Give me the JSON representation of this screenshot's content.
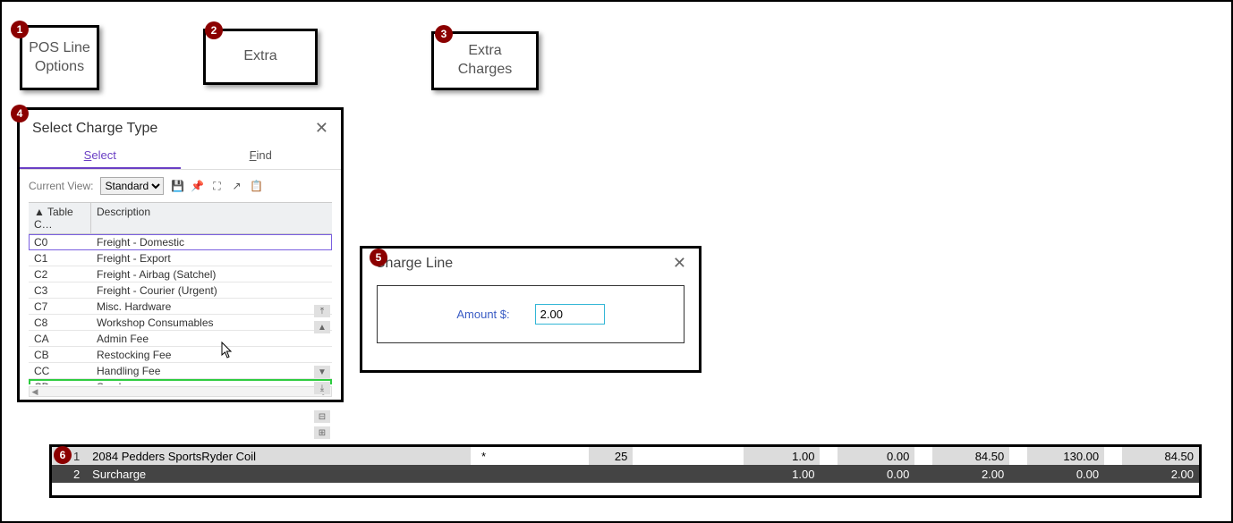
{
  "badges": [
    "1",
    "2",
    "3",
    "4",
    "5",
    "6"
  ],
  "cards": {
    "pos": "POS Line Options",
    "extra": "Extra",
    "charges": "Extra Charges"
  },
  "dlg4": {
    "title": "Select Charge Type",
    "tabs": {
      "select": "Select",
      "find": "Find",
      "select_underlined": "S",
      "find_underlined": "F"
    },
    "toolbar": {
      "label": "Current View:",
      "view": "Standard"
    },
    "cols": {
      "code": "▲ Table C…",
      "desc": "Description"
    },
    "rows": [
      {
        "code": "C0",
        "desc": "Freight - Domestic"
      },
      {
        "code": "C1",
        "desc": "Freight - Export"
      },
      {
        "code": "C2",
        "desc": "Freight - Airbag (Satchel)"
      },
      {
        "code": "C3",
        "desc": "Freight - Courier (Urgent)"
      },
      {
        "code": "C7",
        "desc": "Misc. Hardware"
      },
      {
        "code": "C8",
        "desc": "Workshop Consumables"
      },
      {
        "code": "CA",
        "desc": "Admin Fee"
      },
      {
        "code": "CB",
        "desc": "Restocking Fee"
      },
      {
        "code": "CC",
        "desc": "Handling Fee"
      },
      {
        "code": "CD",
        "desc": "Surcharge"
      }
    ],
    "selected_index": 0,
    "highlight_index": 9
  },
  "dlg5": {
    "title": "Charge Line",
    "label": "Amount $:",
    "value": "2.00"
  },
  "bottom": {
    "rows": [
      {
        "idx": "1",
        "desc": "2084 Pedders SportsRyder Coil",
        "star": "*",
        "qty": "25",
        "n1": "1.00",
        "n2": "0.00",
        "n3": "84.50",
        "n4": "130.00",
        "n5": "84.50"
      },
      {
        "idx": "2",
        "desc": "Surcharge",
        "star": "",
        "qty": "",
        "n1": "1.00",
        "n2": "0.00",
        "n3": "2.00",
        "n4": "0.00",
        "n5": "2.00"
      }
    ]
  }
}
